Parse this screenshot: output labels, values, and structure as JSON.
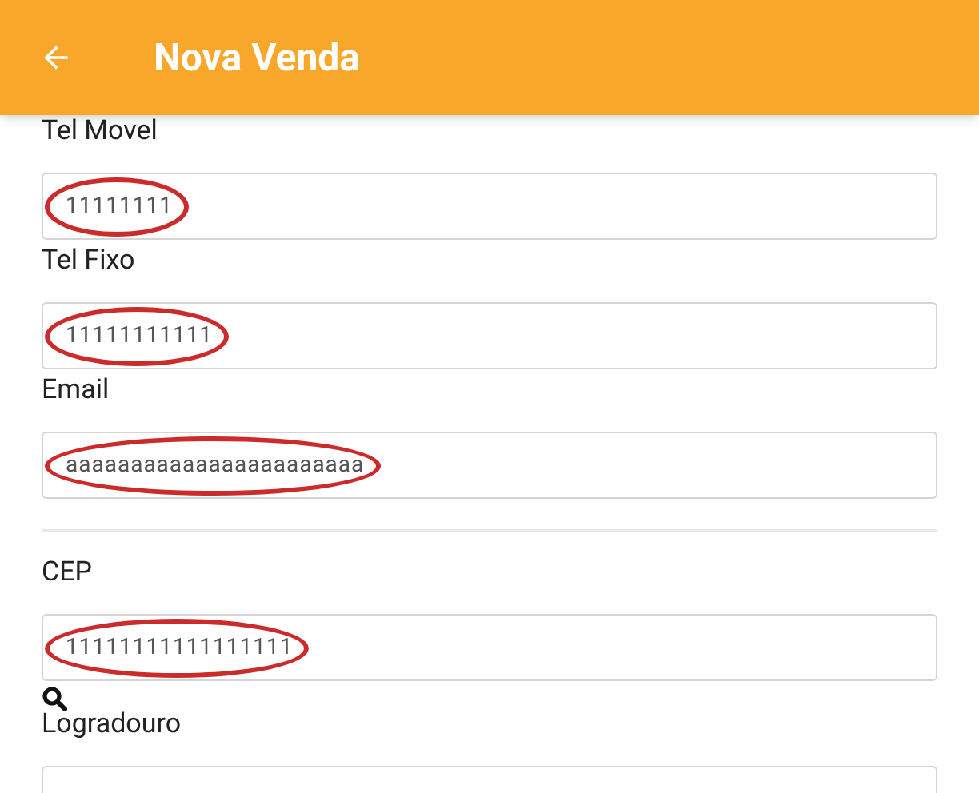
{
  "app_bar": {
    "title": "Nova Venda"
  },
  "fields": [
    {
      "kind": "field",
      "label": "Tel Movel",
      "value": "11111111",
      "highlighted": true
    },
    {
      "kind": "field",
      "label": "Tel Fixo",
      "value": "11111111111",
      "highlighted": true
    },
    {
      "kind": "field",
      "label": "Email",
      "value": "aaaaaaaaaaaaaaaaaaaaaaa",
      "highlighted": true
    },
    {
      "kind": "divider"
    },
    {
      "kind": "field",
      "label": "CEP",
      "value": "11111111111111111",
      "highlighted": true,
      "search": true
    },
    {
      "kind": "field",
      "label": "Logradouro"
    }
  ]
}
